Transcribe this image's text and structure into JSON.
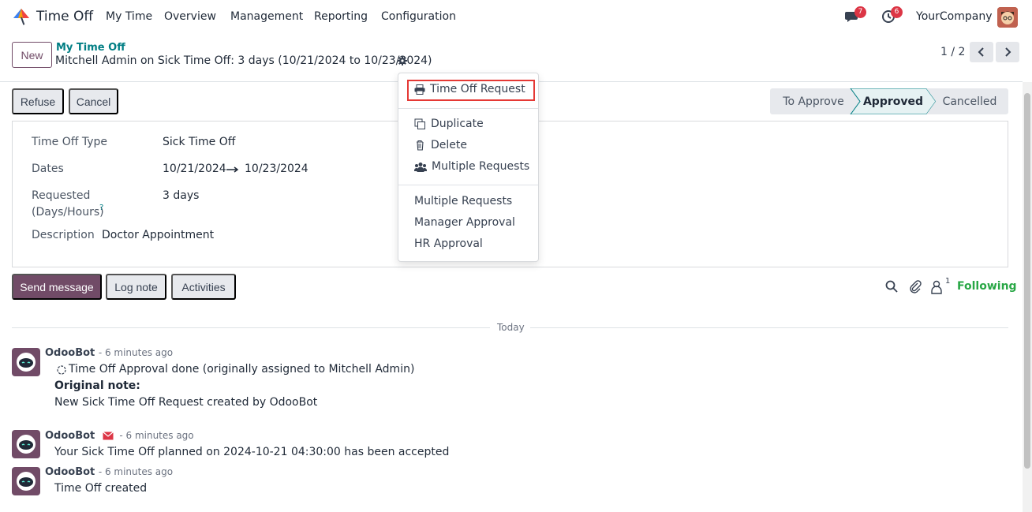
{
  "nav": {
    "app_name": "Time Off",
    "menus": [
      "My Time",
      "Overview",
      "Management",
      "Reporting",
      "Configuration"
    ],
    "messages_count": "7",
    "activities_count": "6",
    "company": "YourCompany"
  },
  "control": {
    "new_label": "New",
    "breadcrumb_parent": "My Time Off",
    "breadcrumb_current": "Mitchell Admin on Sick Time Off: 3 days (10/21/2024 to 10/23/2024)",
    "pager": "1 / 2"
  },
  "status": {
    "refuse_label": "Refuse",
    "cancel_label": "Cancel",
    "stages": [
      "To Approve",
      "Approved",
      "Cancelled"
    ],
    "active_stage": "Approved"
  },
  "form": {
    "type_label": "Time Off Type",
    "type_value": "Sick Time Off",
    "dates_label": "Dates",
    "date_from": "10/21/2024",
    "date_to": "10/23/2024",
    "requested_label_1": "Requested",
    "requested_label_2": "(Days/Hours)",
    "requested_help": "?",
    "requested_value": "3 days",
    "description_label": "Description",
    "description_value": "Doctor Appointment"
  },
  "chatter": {
    "send_message": "Send message",
    "log_note": "Log note",
    "activities": "Activities",
    "followers_count": "1",
    "following": "Following",
    "today": "Today",
    "messages": [
      {
        "author": "OdooBot",
        "time": "- 6 minutes ago",
        "line1": "Time Off Approval done (originally assigned to Mitchell Admin)",
        "line2": "Original note:",
        "line3": "New Sick Time Off Request created by OdooBot"
      },
      {
        "author": "OdooBot",
        "time": "- 6 minutes ago",
        "line1": "Your Sick Time Off planned on 2024-10-21 04:30:00 has been accepted"
      },
      {
        "author": "OdooBot",
        "time": "- 6 minutes ago",
        "line1": "Time Off created"
      }
    ]
  },
  "dropdown": {
    "print_item": "Time Off Request",
    "duplicate": "Duplicate",
    "delete": "Delete",
    "multiple_requests_action": "Multiple Requests",
    "report_multiple": "Multiple Requests",
    "report_manager": "Manager Approval",
    "report_hr": "HR Approval"
  },
  "colors": {
    "brand": "#714b67",
    "link": "#017e84",
    "following": "#28a745",
    "highlight": "#e53935"
  }
}
